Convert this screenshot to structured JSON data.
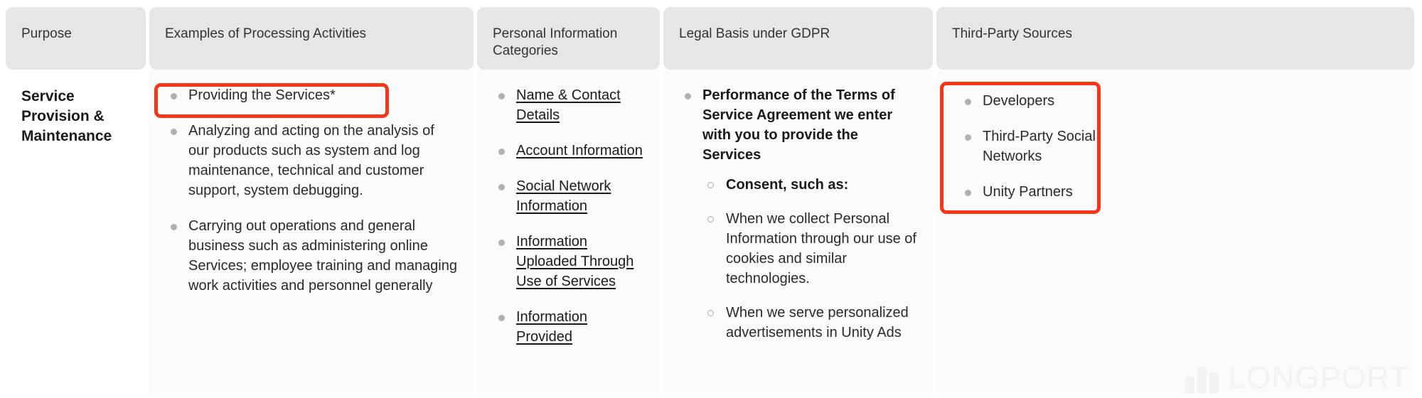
{
  "table": {
    "headers": [
      {
        "label": "Purpose"
      },
      {
        "label": "Examples of Processing Activities"
      },
      {
        "label": "Personal Information Categories"
      },
      {
        "label": "Legal Basis under GDPR"
      },
      {
        "label": "Third-Party Sources"
      }
    ],
    "row": {
      "purpose": "Service Provision & Maintenance",
      "processing_activities": [
        "Providing the Services*",
        "Analyzing and acting on the analysis of our products such as system and log maintenance, technical and customer support, system debugging.",
        "Carrying out operations and general business such as administering online Services; employee training and managing work activities and personnel generally"
      ],
      "personal_information_categories": [
        "Name & Contact Details",
        "Account Information",
        "Social Network Information",
        "Information Uploaded Through Use of Services",
        "Information Provided"
      ],
      "legal_basis": [
        "Performance of the Terms of Service Agreement we enter with you to provide the Services"
      ],
      "legal_basis_sub": [
        "Consent, such as:",
        "When we collect Personal Information through our use of cookies and similar technologies.",
        "When we serve personalized advertisements in Unity Ads"
      ],
      "third_party_sources": [
        "Developers",
        "Third-Party Social Networks",
        "Unity Partners"
      ]
    }
  },
  "highlights": {
    "color": "#f4361a",
    "providing_services_label": "Providing the Services*",
    "third_party_sources_label": "Third-Party Sources list"
  },
  "watermark": {
    "text": "LONGPORT"
  }
}
